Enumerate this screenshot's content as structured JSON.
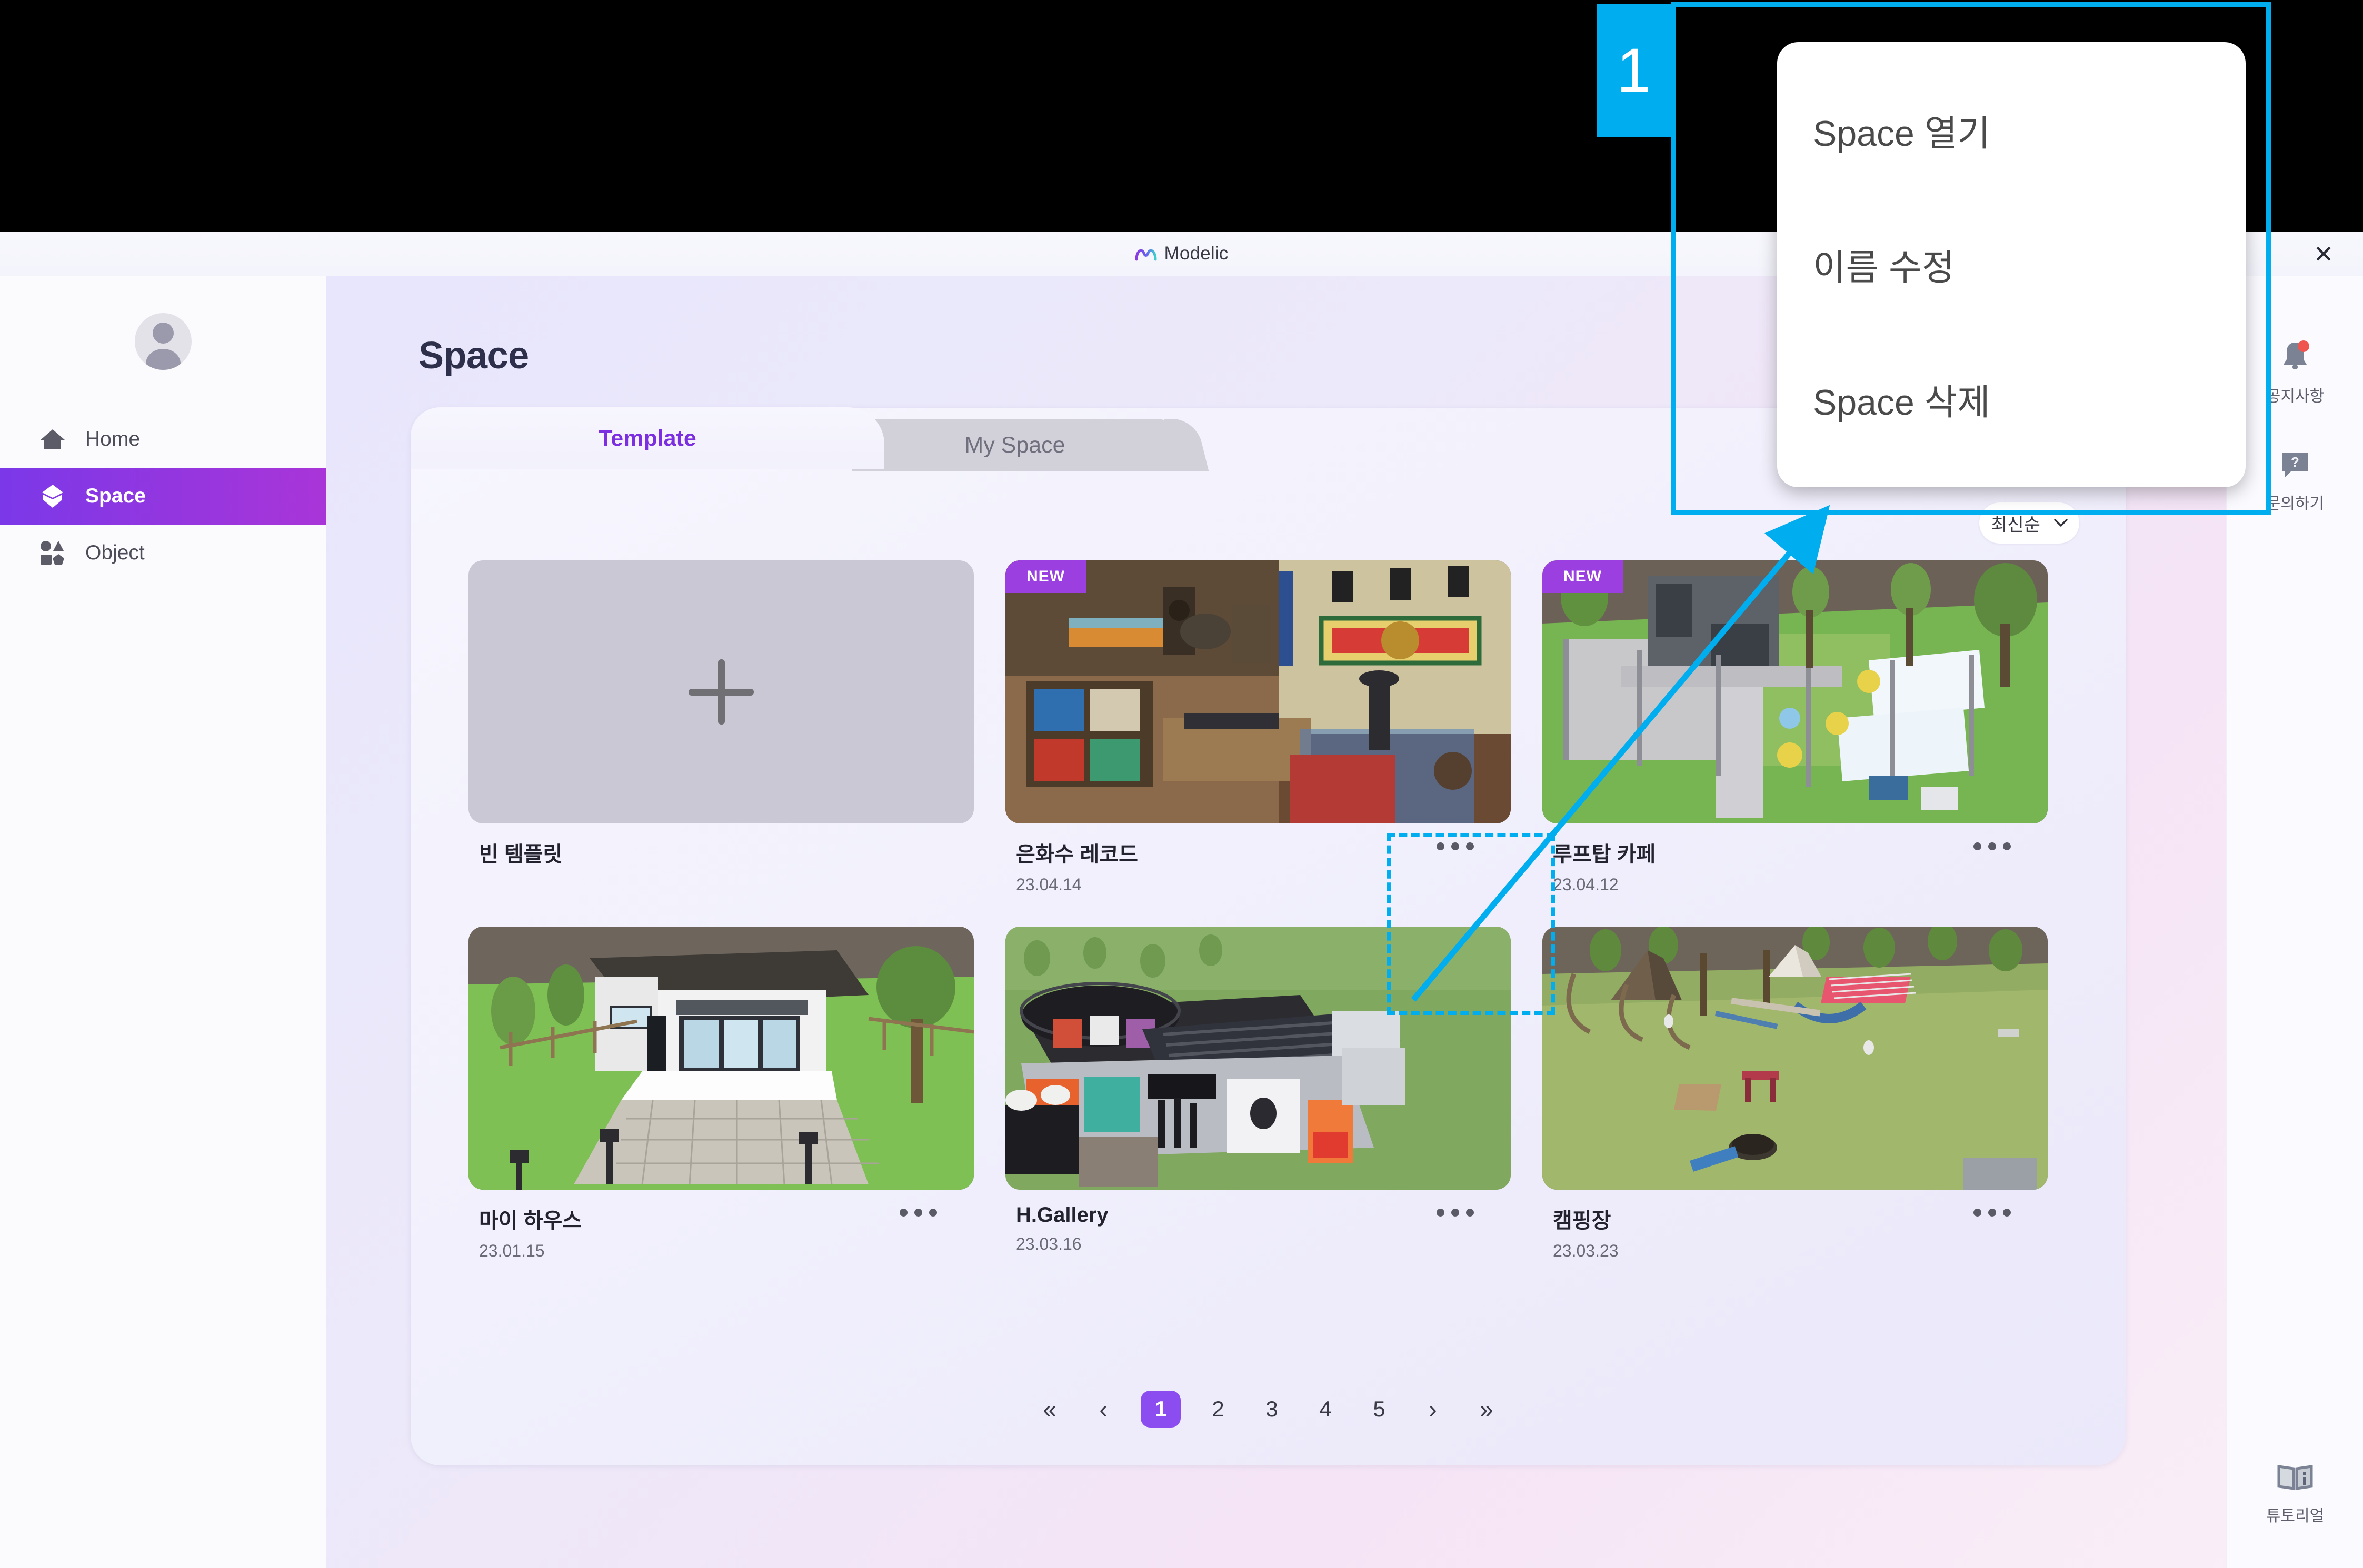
{
  "window": {
    "brand": "Modelic",
    "close_label": "✕"
  },
  "sidebar": {
    "items": [
      {
        "label": "Home",
        "icon": "home-icon",
        "active": false
      },
      {
        "label": "Space",
        "icon": "cube-icon",
        "active": true
      },
      {
        "label": "Object",
        "icon": "shapes-icon",
        "active": false
      }
    ]
  },
  "main": {
    "page_title": "Space",
    "tabs": [
      {
        "label": "Template",
        "active": true
      },
      {
        "label": "My Space",
        "active": false
      }
    ],
    "sort": {
      "label": "최신순",
      "icon": "chevron-down-icon"
    },
    "cards": [
      {
        "name": "빈 템플릿",
        "date": "",
        "badge": "",
        "kind": "empty"
      },
      {
        "name": "은화수 레코드",
        "date": "23.04.14",
        "badge": "NEW",
        "kind": "record-shop"
      },
      {
        "name": "루프탑 카페",
        "date": "23.04.12",
        "badge": "NEW",
        "kind": "rooftop-cafe"
      },
      {
        "name": "마이 하우스",
        "date": "23.01.15",
        "badge": "",
        "kind": "my-house"
      },
      {
        "name": "H.Gallery",
        "date": "23.03.16",
        "badge": "",
        "kind": "gallery"
      },
      {
        "name": "캠핑장",
        "date": "23.03.23",
        "badge": "",
        "kind": "camping"
      }
    ],
    "pagination": {
      "first": "«",
      "prev": "‹",
      "pages": [
        "1",
        "2",
        "3",
        "4",
        "5"
      ],
      "current": "1",
      "next": "›",
      "last": "»"
    }
  },
  "rail": {
    "items": [
      {
        "label": "공지사항",
        "icon": "bell-icon",
        "has_dot": true
      },
      {
        "label": "문의하기",
        "icon": "question-chat-icon",
        "has_dot": false
      },
      {
        "label": "튜토리얼",
        "icon": "book-info-icon",
        "has_dot": false
      }
    ]
  },
  "annotation": {
    "step_number": "1",
    "menu": {
      "items": [
        "Space 열기",
        "이름 수정",
        "Space 삭제"
      ]
    }
  },
  "colors": {
    "accent_purple": "#8b4df0",
    "accent_magenta": "#a935d8",
    "badge_new": "#9b3fe0",
    "annotation_blue": "#00AEEF",
    "notification_red": "#f0544e"
  }
}
